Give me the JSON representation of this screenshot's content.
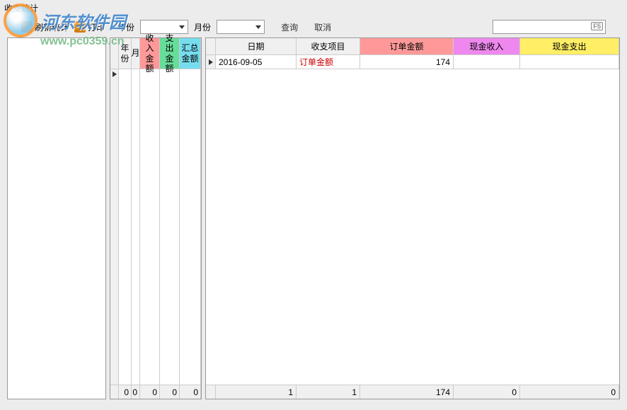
{
  "window": {
    "title": "收支统计"
  },
  "toolbar": {
    "refresh_label": "刷新统计",
    "print_label": "打印",
    "year_label": "年份",
    "month_label": "月份",
    "query_label": "查询",
    "cancel_label": "取消",
    "search_key_hint": "F5"
  },
  "summary": {
    "headers": {
      "year": "年份",
      "month": "月",
      "income": "收入金额",
      "expense": "支出金额",
      "total": "汇总金额"
    },
    "footer": {
      "year": "0",
      "month": "0",
      "income": "0",
      "expense": "0",
      "total": "0"
    }
  },
  "detail": {
    "headers": {
      "date": "日期",
      "item": "收支项目",
      "order_amount": "订单金额",
      "cash_in": "现金收入",
      "cash_out": "现金支出"
    },
    "rows": [
      {
        "date": "2016-09-05",
        "item": "订单金额",
        "order_amount": "174",
        "cash_in": "",
        "cash_out": ""
      }
    ],
    "footer": {
      "count1": "1",
      "count2": "1",
      "order_amount": "174",
      "cash_in": "0",
      "cash_out": "0"
    }
  },
  "watermark": {
    "brand": "河东软件园",
    "url": "www.pc0359.cn"
  }
}
